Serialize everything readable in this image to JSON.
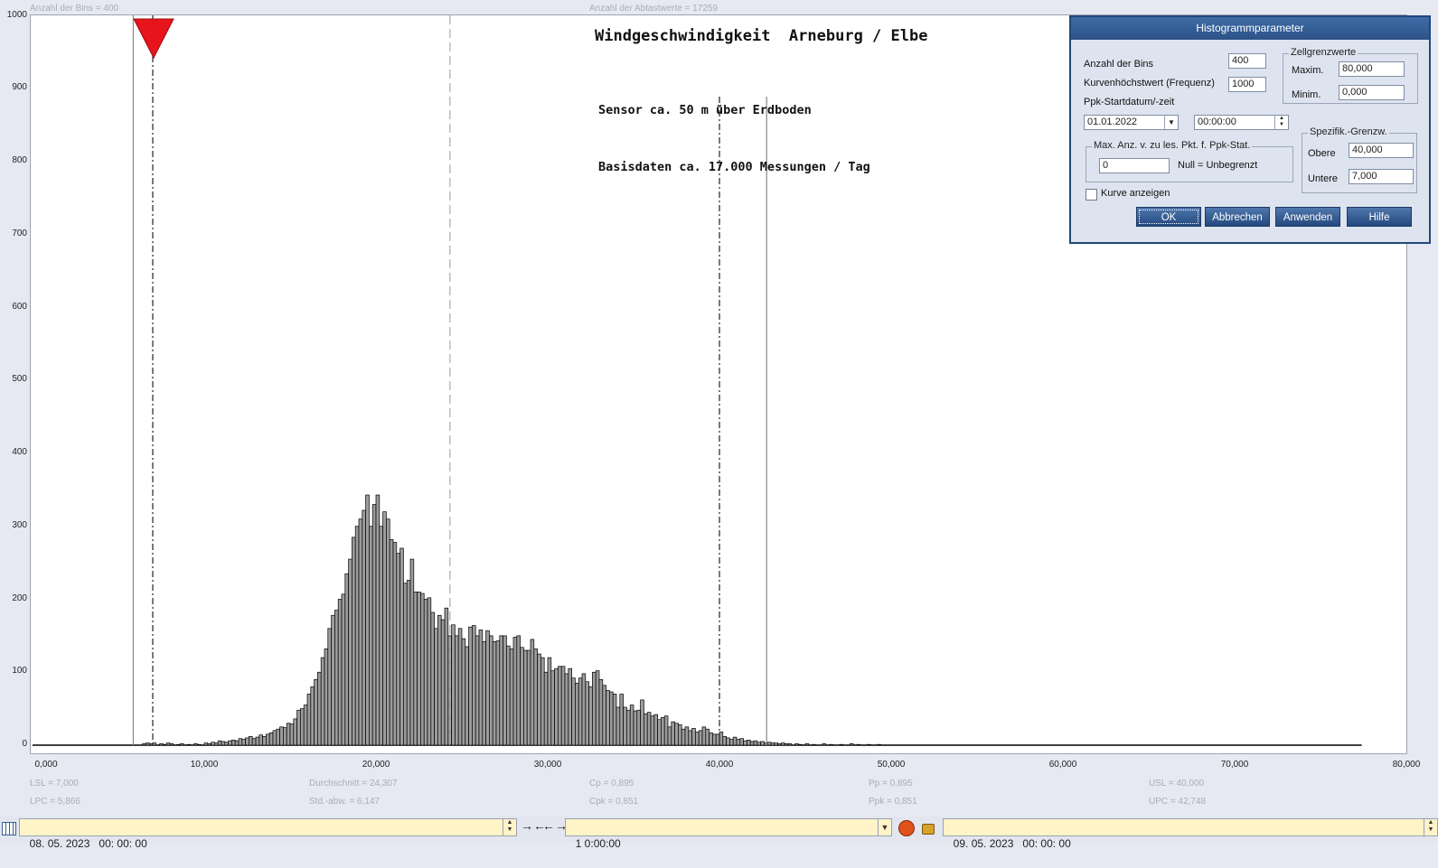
{
  "header": {
    "bins_info": "Anzahl der Bins =   400",
    "samples_info": "Anzahl der Abtastwerte = 17259"
  },
  "chart_data": {
    "type": "bar",
    "title": "Windgeschwindigkeit  Arneburg / Elbe",
    "subtitle_lines": [
      "Sensor ca. 50 m über Erdboden",
      "Basisdaten ca. 17.000 Messungen / Tag"
    ],
    "xlim": [
      0,
      80
    ],
    "ylim": [
      0,
      1000
    ],
    "bin_width": 0.2,
    "y_ticks": [
      "0",
      "100",
      "200",
      "300",
      "400",
      "500",
      "600",
      "700",
      "800",
      "900",
      "1000"
    ],
    "x_ticks": [
      "0,000",
      "10,000",
      "20,000",
      "30,000",
      "40,000",
      "50,000",
      "60,000",
      "70,000",
      "80,000"
    ],
    "x_tick_values": [
      0,
      10,
      20,
      30,
      40,
      50,
      60,
      70,
      80
    ],
    "bins": [
      [
        6.4,
        2
      ],
      [
        6.6,
        3
      ],
      [
        6.8,
        2
      ],
      [
        7.0,
        3
      ],
      [
        7.4,
        2
      ],
      [
        7.6,
        1
      ],
      [
        7.8,
        3
      ],
      [
        8.0,
        2
      ],
      [
        8.4,
        1
      ],
      [
        8.6,
        2
      ],
      [
        9.0,
        1
      ],
      [
        9.4,
        2
      ],
      [
        9.6,
        1
      ],
      [
        10.0,
        3
      ],
      [
        10.2,
        2
      ],
      [
        10.4,
        4
      ],
      [
        10.6,
        3
      ],
      [
        10.8,
        6
      ],
      [
        11.0,
        5
      ],
      [
        11.2,
        4
      ],
      [
        11.4,
        6
      ],
      [
        11.6,
        7
      ],
      [
        11.8,
        6
      ],
      [
        12.0,
        9
      ],
      [
        12.2,
        8
      ],
      [
        12.4,
        10
      ],
      [
        12.6,
        12
      ],
      [
        12.8,
        9
      ],
      [
        13.0,
        11
      ],
      [
        13.2,
        14
      ],
      [
        13.4,
        12
      ],
      [
        13.6,
        15
      ],
      [
        13.8,
        17
      ],
      [
        14.0,
        20
      ],
      [
        14.2,
        22
      ],
      [
        14.4,
        25
      ],
      [
        14.6,
        24
      ],
      [
        14.8,
        30
      ],
      [
        15.0,
        29
      ],
      [
        15.2,
        36
      ],
      [
        15.4,
        48
      ],
      [
        15.6,
        50
      ],
      [
        15.8,
        55
      ],
      [
        16.0,
        70
      ],
      [
        16.2,
        80
      ],
      [
        16.4,
        90
      ],
      [
        16.6,
        100
      ],
      [
        16.8,
        120
      ],
      [
        17.0,
        132
      ],
      [
        17.2,
        160
      ],
      [
        17.4,
        178
      ],
      [
        17.6,
        185
      ],
      [
        17.8,
        200
      ],
      [
        18.0,
        207
      ],
      [
        18.2,
        235
      ],
      [
        18.4,
        255
      ],
      [
        18.6,
        285
      ],
      [
        18.8,
        300
      ],
      [
        19.0,
        310
      ],
      [
        19.2,
        322
      ],
      [
        19.4,
        343
      ],
      [
        19.6,
        300
      ],
      [
        19.8,
        330
      ],
      [
        20.0,
        343
      ],
      [
        20.2,
        300
      ],
      [
        20.4,
        320
      ],
      [
        20.6,
        310
      ],
      [
        20.8,
        282
      ],
      [
        21.0,
        278
      ],
      [
        21.2,
        263
      ],
      [
        21.4,
        270
      ],
      [
        21.6,
        222
      ],
      [
        21.8,
        226
      ],
      [
        22.0,
        255
      ],
      [
        22.2,
        210
      ],
      [
        22.4,
        210
      ],
      [
        22.6,
        208
      ],
      [
        22.8,
        200
      ],
      [
        23.0,
        202
      ],
      [
        23.2,
        182
      ],
      [
        23.4,
        160
      ],
      [
        23.6,
        178
      ],
      [
        23.8,
        172
      ],
      [
        24.0,
        188
      ],
      [
        24.2,
        150
      ],
      [
        24.4,
        165
      ],
      [
        24.6,
        150
      ],
      [
        24.8,
        160
      ],
      [
        25.0,
        146
      ],
      [
        25.2,
        135
      ],
      [
        25.4,
        162
      ],
      [
        25.6,
        164
      ],
      [
        25.8,
        150
      ],
      [
        26.0,
        158
      ],
      [
        26.2,
        142
      ],
      [
        26.4,
        157
      ],
      [
        26.6,
        150
      ],
      [
        26.8,
        142
      ],
      [
        27.0,
        143
      ],
      [
        27.2,
        150
      ],
      [
        27.4,
        150
      ],
      [
        27.6,
        136
      ],
      [
        27.8,
        132
      ],
      [
        28.0,
        148
      ],
      [
        28.2,
        150
      ],
      [
        28.4,
        134
      ],
      [
        28.6,
        130
      ],
      [
        28.8,
        130
      ],
      [
        29.0,
        145
      ],
      [
        29.2,
        132
      ],
      [
        29.4,
        125
      ],
      [
        29.6,
        120
      ],
      [
        29.8,
        100
      ],
      [
        30.0,
        120
      ],
      [
        30.2,
        102
      ],
      [
        30.4,
        105
      ],
      [
        30.6,
        108
      ],
      [
        30.8,
        108
      ],
      [
        31.0,
        98
      ],
      [
        31.2,
        105
      ],
      [
        31.4,
        92
      ],
      [
        31.6,
        85
      ],
      [
        31.8,
        92
      ],
      [
        32.0,
        98
      ],
      [
        32.2,
        87
      ],
      [
        32.4,
        80
      ],
      [
        32.6,
        100
      ],
      [
        32.8,
        102
      ],
      [
        33.0,
        90
      ],
      [
        33.2,
        82
      ],
      [
        33.4,
        75
      ],
      [
        33.6,
        73
      ],
      [
        33.8,
        70
      ],
      [
        34.0,
        52
      ],
      [
        34.2,
        70
      ],
      [
        34.4,
        52
      ],
      [
        34.6,
        48
      ],
      [
        34.8,
        55
      ],
      [
        35.0,
        47
      ],
      [
        35.2,
        48
      ],
      [
        35.4,
        62
      ],
      [
        35.6,
        43
      ],
      [
        35.8,
        45
      ],
      [
        36.0,
        40
      ],
      [
        36.2,
        42
      ],
      [
        36.4,
        35
      ],
      [
        36.6,
        38
      ],
      [
        36.8,
        40
      ],
      [
        37.0,
        25
      ],
      [
        37.2,
        32
      ],
      [
        37.4,
        30
      ],
      [
        37.6,
        28
      ],
      [
        37.8,
        22
      ],
      [
        38.0,
        25
      ],
      [
        38.2,
        20
      ],
      [
        38.4,
        23
      ],
      [
        38.6,
        18
      ],
      [
        38.8,
        20
      ],
      [
        39.0,
        25
      ],
      [
        39.2,
        22
      ],
      [
        39.4,
        17
      ],
      [
        39.6,
        15
      ],
      [
        39.8,
        15
      ],
      [
        40.0,
        18
      ],
      [
        40.2,
        12
      ],
      [
        40.4,
        10
      ],
      [
        40.6,
        8
      ],
      [
        40.8,
        11
      ],
      [
        41.0,
        8
      ],
      [
        41.2,
        9
      ],
      [
        41.4,
        6
      ],
      [
        41.6,
        7
      ],
      [
        41.8,
        5
      ],
      [
        42.0,
        6
      ],
      [
        42.2,
        4
      ],
      [
        42.4,
        5
      ],
      [
        42.6,
        3
      ],
      [
        42.8,
        4
      ],
      [
        43.0,
        3
      ],
      [
        43.2,
        3
      ],
      [
        43.4,
        2
      ],
      [
        43.6,
        3
      ],
      [
        43.8,
        2
      ],
      [
        44.0,
        2
      ],
      [
        44.4,
        2
      ],
      [
        44.6,
        1
      ],
      [
        45.0,
        2
      ],
      [
        45.4,
        1
      ],
      [
        46.0,
        2
      ],
      [
        46.4,
        1
      ],
      [
        47.0,
        1
      ],
      [
        47.6,
        2
      ],
      [
        48.0,
        1
      ],
      [
        48.6,
        1
      ],
      [
        49.2,
        1
      ]
    ],
    "reference_lines": [
      {
        "name": "LPC",
        "x": 5.866,
        "style": "solid"
      },
      {
        "name": "LSL",
        "x": 7.0,
        "style": "dashdot"
      },
      {
        "name": "mean",
        "x": 24.307,
        "style": "dashed"
      },
      {
        "name": "USL",
        "x": 40.0,
        "style": "dashdot"
      },
      {
        "name": "UPC",
        "x": 42.748,
        "style": "solid"
      }
    ],
    "stats": {
      "lsl": "LSL = 7,000",
      "lpc": "LPC = 5,866",
      "mean": "Durchschnitt  = 24,307",
      "std": "Std.-abw.  = 6,147",
      "cp": "Cp  = 0,895",
      "cpk": "Cpk = 0,851",
      "pp": "Pp  = 0,895",
      "ppk": "Ppk = 0,851",
      "usl": "USL = 40,000",
      "upc": "UPC = 42,748"
    }
  },
  "dialog": {
    "title": "Histogrammparameter",
    "bins_label": "Anzahl der Bins",
    "bins_value": "400",
    "max_freq_label": "Kurvenhöchstwert (Frequenz)",
    "max_freq_value": "1000",
    "ppk_label": "Ppk-Startdatum/-zeit",
    "date_value": "01.01.2022",
    "time_value": "00:00:00",
    "cell_limits_title": "Zellgrenzwerte",
    "max_label": "Maxim.",
    "max_value": "80,000",
    "min_label": "Minim.",
    "min_value": "0,000",
    "max_points_title": "Max. Anz. v. zu les. Pkt. f. Ppk-Stat.",
    "max_points_value": "0",
    "null_hint": "Null = Unbegrenzt",
    "spec_title": "Spezifik.-Grenzw.",
    "upper_label": "Obere",
    "upper_value": "40,000",
    "lower_label": "Untere",
    "lower_value": "7,000",
    "curve_label": "Kurve anzeigen",
    "buttons": {
      "ok": "OK",
      "cancel": "Abbrechen",
      "apply": "Anwenden",
      "help": "Hilfe"
    }
  },
  "footer": {
    "start": "08. 05. 2023   00: 00: 00",
    "interval": "1 0:00:00",
    "end": "09. 05. 2023   00: 00: 00"
  },
  "colors": {
    "bar_fill": "#9c9c9c",
    "marker": "#e8141c",
    "dialog_title": "#2c5387"
  }
}
